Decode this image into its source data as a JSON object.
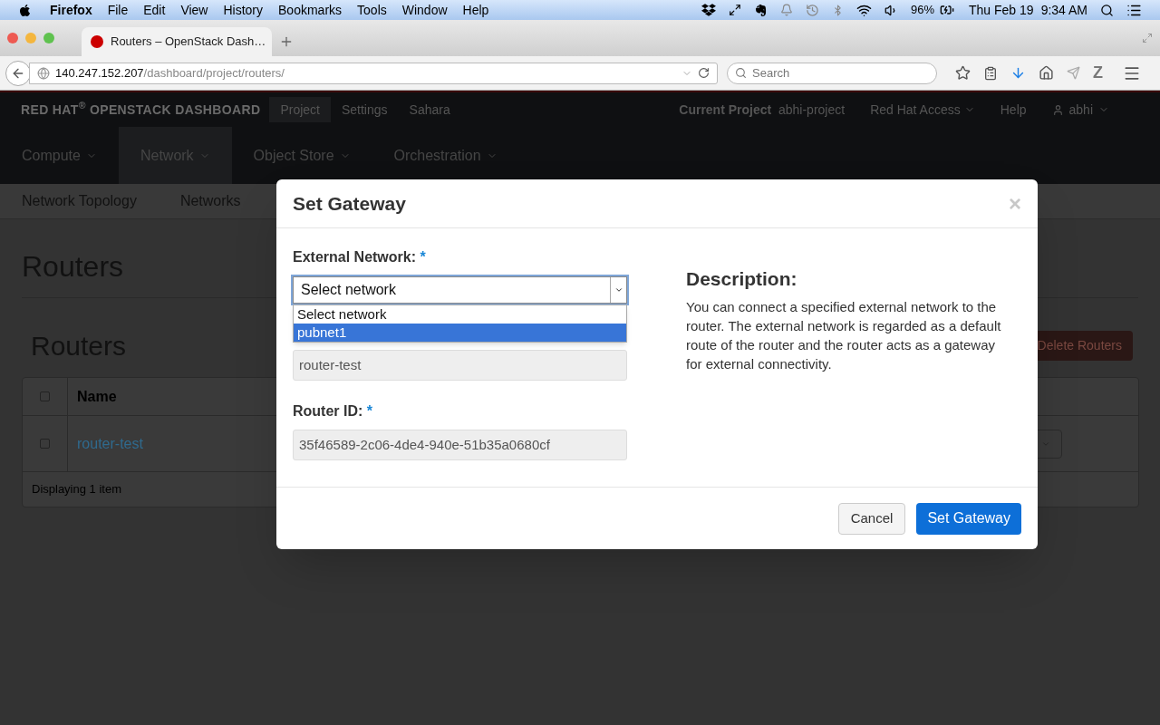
{
  "menubar": {
    "app": "Firefox",
    "items": [
      "File",
      "Edit",
      "View",
      "History",
      "Bookmarks",
      "Tools",
      "Window",
      "Help"
    ],
    "battery": "96%",
    "date": "Thu Feb 19",
    "time": "9:34 AM"
  },
  "browser": {
    "tabs": [
      {
        "title": "Routers – OpenStack Dash…",
        "selected": true
      }
    ],
    "url_host": "140.247.152.207",
    "url_path": "/dashboard/project/routers/",
    "search": {
      "placeholder": "Search"
    },
    "addon_glyph": "Z"
  },
  "topnav": {
    "brand": "RED HAT$^{®}$ OPENSTACK DASHBOARD",
    "items": [
      {
        "label": "Project",
        "selected": true
      },
      {
        "label": "Settings",
        "selected": false
      },
      {
        "label": "Sahara",
        "selected": false
      }
    ],
    "current_project_label": "Current Project",
    "current_project": "abhi-project",
    "access": "Red Hat Access",
    "help": "Help",
    "user": "abhi"
  },
  "mainnav": [
    {
      "label": "Compute",
      "selected": false
    },
    {
      "label": "Network",
      "selected": true
    },
    {
      "label": "Object Store",
      "selected": false
    },
    {
      "label": "Orchestration",
      "selected": false
    }
  ],
  "subnav": [
    "Network Topology",
    "Networks"
  ],
  "page": {
    "title": "Routers",
    "section_title": "Routers",
    "delete_button": "Delete Routers",
    "table": {
      "select_all_checked": false,
      "columns": [
        "Name"
      ],
      "rows": [
        {
          "name": "router-test",
          "checked": false
        }
      ],
      "footer": "Displaying 1 item"
    }
  },
  "modal": {
    "title": "Set Gateway",
    "close": "×",
    "external_network": {
      "label": "External Network:",
      "required": "*",
      "value": "Select network",
      "expanded": true,
      "options": [
        {
          "label": "Select network",
          "highlighted": false
        },
        {
          "label": "pubnet1",
          "highlighted": true
        }
      ]
    },
    "router_name": {
      "value": "router-test"
    },
    "router_id": {
      "label": "Router ID:",
      "required": "*",
      "value": "35f46589-2c06-4de4-940e-51b35a0680cf"
    },
    "description_title": "Description:",
    "description": "You can connect a specified external network to the router. The external network is regarded as a default route of the router and the router acts as a gateway for external connectivity.",
    "cancel": "Cancel",
    "submit": "Set Gateway"
  }
}
